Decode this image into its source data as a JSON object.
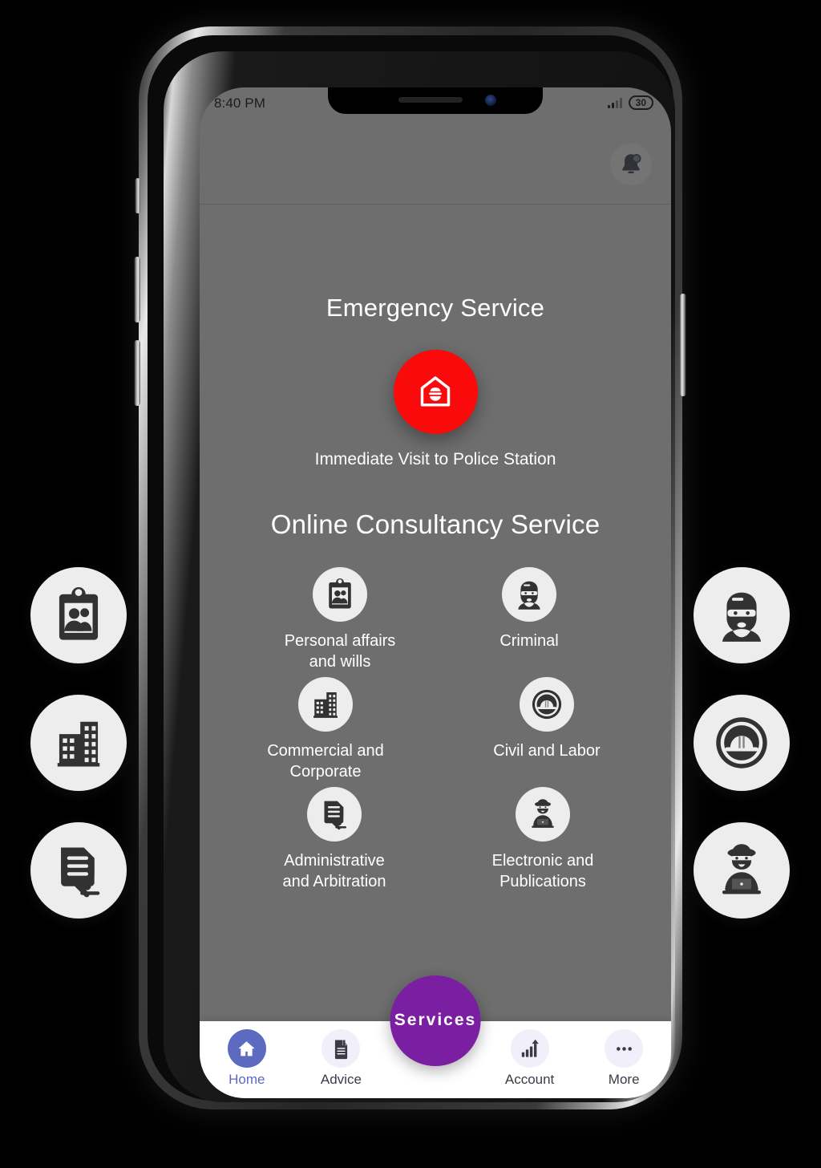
{
  "status_bar": {
    "time": "8:40 PM",
    "battery_level": "30",
    "signal_icon": "signal-bars-icon",
    "battery_icon": "battery-icon"
  },
  "app_bar": {
    "notification_icon": "notification-bell-icon"
  },
  "emergency": {
    "title": "Emergency Service",
    "button_icon": "police-station-icon",
    "button_color": "#FA0A0A",
    "caption": "Immediate Visit to Police Station"
  },
  "consultancy": {
    "title": "Online Consultancy Service",
    "items": [
      {
        "label": "Personal affairs\nand wills",
        "line1": "Personal affairs",
        "line2": "and wills",
        "icon": "clipboard-people-icon"
      },
      {
        "label": "Criminal",
        "line1": "Criminal",
        "line2": "",
        "icon": "masked-criminal-icon"
      },
      {
        "label": "Commercial and\nCorporate",
        "line1": "Commercial and",
        "line2": "Corporate",
        "icon": "office-buildings-icon"
      },
      {
        "label": "Civil and Labor",
        "line1": "Civil and Labor",
        "line2": "",
        "icon": "hard-hat-icon"
      },
      {
        "label": "Administrative\nand Arbitration",
        "line1": "Administrative",
        "line2": "and Arbitration",
        "icon": "document-gavel-icon"
      },
      {
        "label": "Electronic and\nPublications",
        "line1": "Electronic and",
        "line2": "Publications",
        "icon": "hacker-laptop-icon"
      }
    ]
  },
  "fab": {
    "label": "Services",
    "color": "#7B1FA2"
  },
  "bottom_nav": {
    "active_color": "#5C6BC0",
    "items": [
      {
        "label": "Home",
        "icon": "home-icon",
        "active": true
      },
      {
        "label": "Advice",
        "icon": "document-bookmark-icon",
        "active": false
      },
      {
        "label": "Account",
        "icon": "bar-chart-arrow-icon",
        "active": false
      },
      {
        "label": "More",
        "icon": "three-dots-icon",
        "active": false
      }
    ]
  },
  "callouts": {
    "left": [
      {
        "icon": "clipboard-people-icon"
      },
      {
        "icon": "office-buildings-icon"
      },
      {
        "icon": "document-gavel-icon"
      }
    ],
    "right": [
      {
        "icon": "masked-criminal-icon"
      },
      {
        "icon": "hard-hat-icon"
      },
      {
        "icon": "hacker-laptop-icon"
      }
    ]
  }
}
